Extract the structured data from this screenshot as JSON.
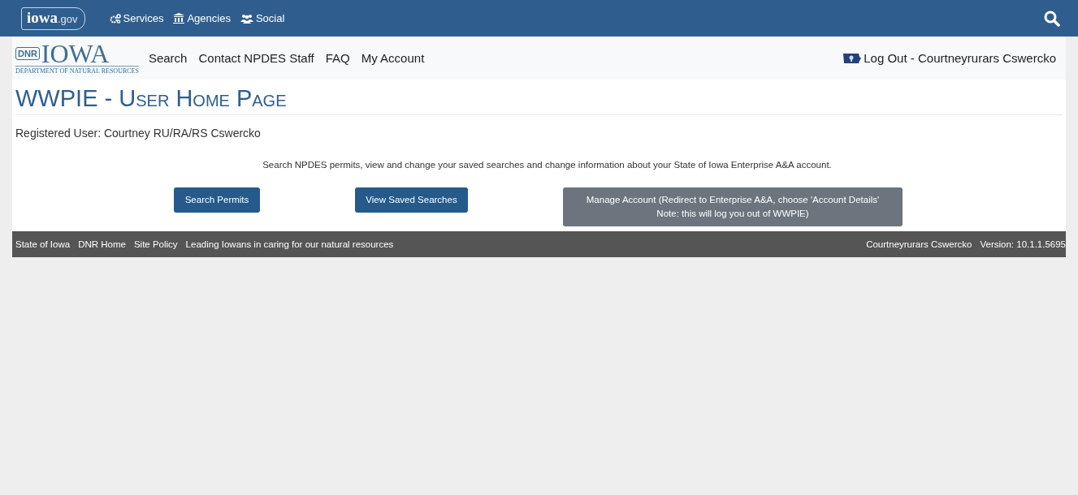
{
  "top_bar": {
    "logo": {
      "main": "iowa",
      "suffix": ".gov"
    },
    "links": [
      {
        "label": "Services"
      },
      {
        "label": "Agencies"
      },
      {
        "label": "Social"
      }
    ]
  },
  "nav": {
    "logo": {
      "badge": "DNR",
      "name": "IOWA",
      "subtitle": "DEPARTMENT OF NATURAL RESOURCES"
    },
    "links": [
      "Search",
      "Contact NPDES Staff",
      "FAQ",
      "My Account"
    ],
    "logout": "Log Out - Courtneyrurars Cswercko"
  },
  "page": {
    "title": "WWPIE - User Home Page",
    "registered_user": "Registered User: Courtney RU/RA/RS Cswercko",
    "intro": "Search NPDES permits, view and change your saved searches and change information about your State of Iowa Enterprise A&A account.",
    "buttons": [
      {
        "kind": "primary",
        "lines": [
          "Search Permits"
        ]
      },
      {
        "kind": "primary",
        "lines": [
          "View Saved Searches"
        ]
      },
      {
        "kind": "secondary",
        "lines": [
          "Manage Account (Redirect to Enterprise A&A, choose 'Account Details'",
          "Note: this will log you out of WWPIE)"
        ]
      }
    ]
  },
  "footer": {
    "links": [
      "State of Iowa",
      "DNR Home",
      "Site Policy"
    ],
    "tagline": "Leading Iowans in caring for our natural resources",
    "user": "Courtneyrurars Cswercko",
    "version": "Version: 10.1.1.5695"
  }
}
